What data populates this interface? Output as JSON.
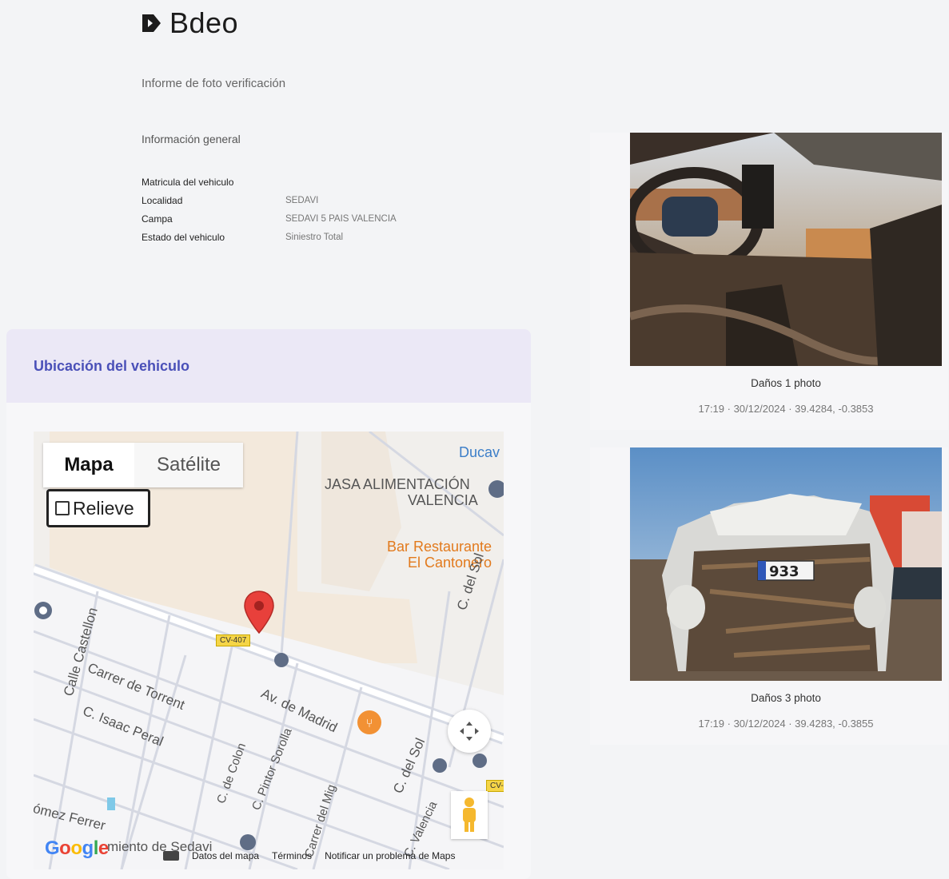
{
  "brand": {
    "name": "Bdeo"
  },
  "report": {
    "title": "Informe de foto verificación"
  },
  "general": {
    "title": "Información general",
    "rows": [
      {
        "label": "Matricula del vehiculo",
        "value": ""
      },
      {
        "label": "Localidad",
        "value": "SEDAVI"
      },
      {
        "label": "Campa",
        "value": "SEDAVI 5 PAIS VALENCIA"
      },
      {
        "label": "Estado del vehiculo",
        "value": "Siniestro Total"
      }
    ]
  },
  "location": {
    "title": "Ubicación del vehiculo",
    "map": {
      "type_mapa": "Mapa",
      "type_satelite": "Satélite",
      "relieve": "Relieve",
      "road_badge": "CV-407",
      "road_badge_2": "CV-",
      "labels": {
        "ducav": "Ducav",
        "jasa_1": "JASA ALIMENTACIÓN",
        "jasa_2": "VALENCIA",
        "bar_1": "Bar Restaurante",
        "bar_2": "El Cantonero",
        "c_del_sol_top": "C. del Sol",
        "calle_castellon": "Calle Castellon",
        "carrer_torrent": "Carrer de Torrent",
        "av_madrid": "Av. de Madrid",
        "isaac_peral": "C. Isaac Peral",
        "c_colon": "C. de Colon",
        "pintor_sorolla": "C. Pintor Sorolla",
        "c_del_sol_bottom": "C. del Sol",
        "carrer_mig": "Carrer del Mig",
        "c_valencia": "C. Valencia",
        "gomez_ferrer": "ómez Ferrer",
        "ayuntamiento": "miento de Sedavi"
      },
      "google": "Google",
      "attribution": {
        "datos": "Datos del mapa",
        "terminos": "Términos",
        "notificar": "Notificar un problema de Maps"
      }
    }
  },
  "photos": [
    {
      "caption": "Daños 1 photo",
      "meta": "17:19 · 30/12/2024 · 39.4284, -0.3853"
    },
    {
      "caption": "Daños 3 photo",
      "meta": "17:19 · 30/12/2024 · 39.4283, -0.3855",
      "plate_text": "933"
    }
  ]
}
